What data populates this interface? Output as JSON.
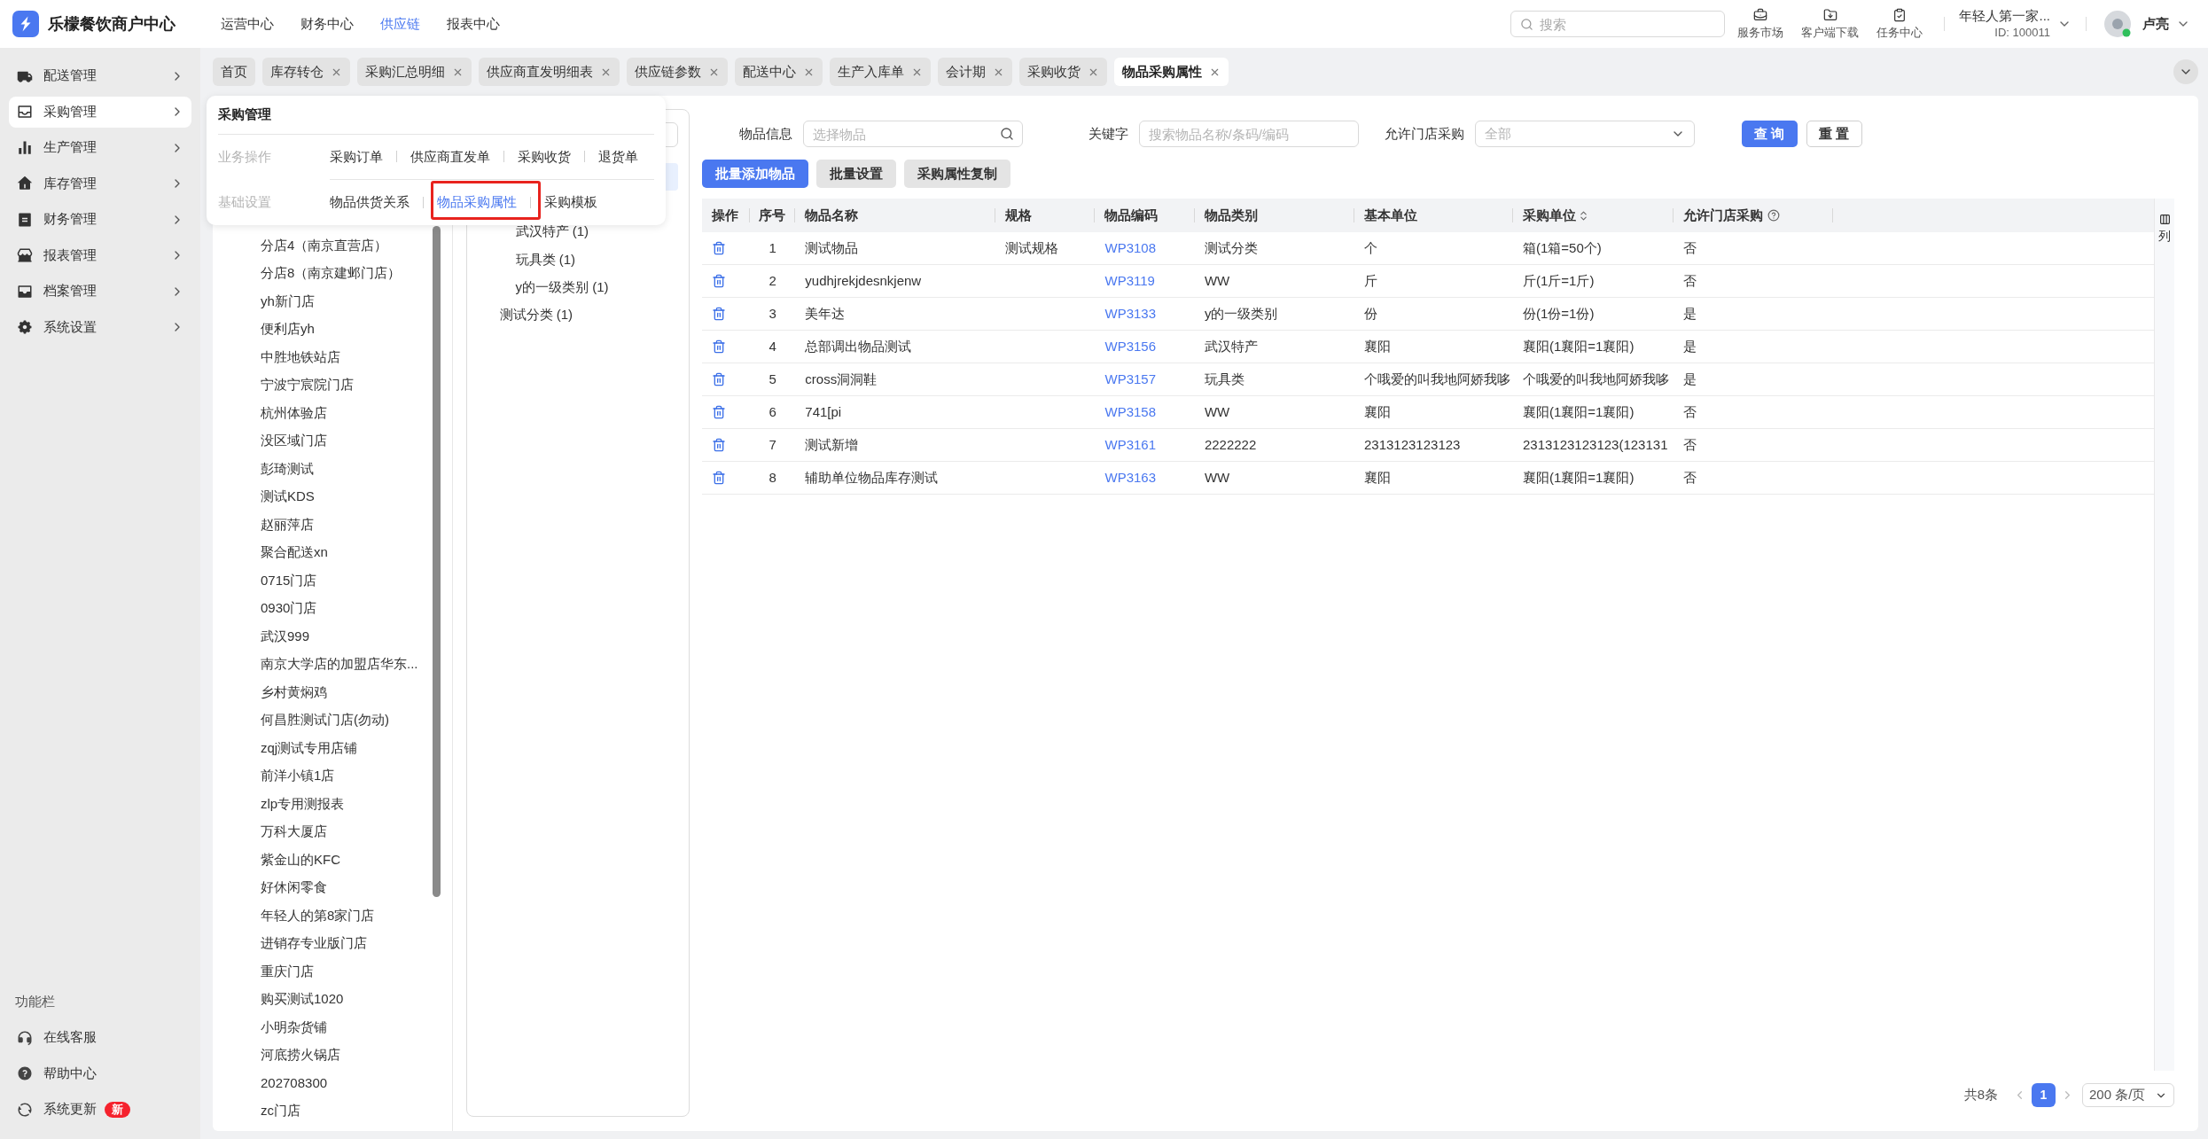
{
  "header": {
    "title": "乐檬餐饮商户中心",
    "nav": [
      {
        "label": "运营中心",
        "selected": false
      },
      {
        "label": "财务中心",
        "selected": false
      },
      {
        "label": "供应链",
        "selected": true
      },
      {
        "label": "报表中心",
        "selected": false
      }
    ],
    "search": {
      "placeholder": "搜索"
    },
    "tools": [
      {
        "label": "服务市场",
        "kind": "market"
      },
      {
        "label": "客户端下载",
        "kind": "download"
      },
      {
        "label": "任务中心",
        "kind": "tasks"
      }
    ],
    "account": {
      "name": "年轻人第一家...",
      "id": "ID: 100011"
    },
    "user": {
      "name": "卢亮"
    }
  },
  "sidebar": {
    "items": [
      {
        "label": "配送管理",
        "kind": "truck",
        "selected": false
      },
      {
        "label": "采购管理",
        "kind": "tray",
        "selected": true
      },
      {
        "label": "生产管理",
        "kind": "chart",
        "selected": false
      },
      {
        "label": "库存管理",
        "kind": "house",
        "selected": false
      },
      {
        "label": "财务管理",
        "kind": "bill",
        "selected": false
      },
      {
        "label": "报表管理",
        "kind": "store",
        "selected": false
      },
      {
        "label": "档案管理",
        "kind": "archive",
        "selected": false
      },
      {
        "label": "系统设置",
        "kind": "gear",
        "selected": false
      }
    ],
    "footer": {
      "title": "功能栏",
      "items": [
        {
          "label": "在线客服",
          "kind": "service"
        },
        {
          "label": "帮助中心",
          "kind": "help"
        },
        {
          "label": "系统更新",
          "kind": "update",
          "badge": "新"
        }
      ]
    }
  },
  "tabs": [
    {
      "label": "首页",
      "closable": false,
      "selected": false
    },
    {
      "label": "库存转仓",
      "closable": true,
      "selected": false
    },
    {
      "label": "采购汇总明细",
      "closable": true,
      "selected": false
    },
    {
      "label": "供应商直发明细表",
      "closable": true,
      "selected": false
    },
    {
      "label": "供应链参数",
      "closable": true,
      "selected": false
    },
    {
      "label": "配送中心",
      "closable": true,
      "selected": false
    },
    {
      "label": "生产入库单",
      "closable": true,
      "selected": false
    },
    {
      "label": "会计期",
      "closable": true,
      "selected": false
    },
    {
      "label": "采购收货",
      "closable": true,
      "selected": false
    },
    {
      "label": "物品采购属性",
      "closable": true,
      "selected": true
    }
  ],
  "menu": {
    "title": "采购管理",
    "groups": [
      {
        "label": "业务操作",
        "links": [
          {
            "label": "采购订单",
            "selected": false,
            "outlined": false
          },
          {
            "label": "供应商直发单",
            "selected": false,
            "outlined": false
          },
          {
            "label": "采购收货",
            "selected": false,
            "outlined": false
          },
          {
            "label": "退货单",
            "selected": false,
            "outlined": false
          }
        ]
      },
      {
        "label": "基础设置",
        "links": [
          {
            "label": "物品供货关系",
            "selected": false,
            "outlined": false
          },
          {
            "label": "物品采购属性",
            "selected": true,
            "outlined": true
          },
          {
            "label": "采购模板",
            "selected": false,
            "outlined": false
          }
        ]
      }
    ]
  },
  "stores": [
    "分店4（南京直营店）",
    "分店8（南京建邺门店）",
    "yh新门店",
    "便利店yh",
    "中胜地铁站店",
    "宁波宁宸院门店",
    "杭州体验店",
    "没区域门店",
    "彭琦测试",
    "测试KDS",
    "赵丽萍店",
    "聚合配送xn",
    "0715门店",
    "0930门店",
    "武汉999",
    "南京大学店的加盟店华东...",
    "乡村黄焖鸡",
    "何昌胜测试门店(勿动)",
    "zqj测试专用店铺",
    "前洋小镇1店",
    "zlp专用测报表",
    "万科大厦店",
    "紫金山的KFC",
    "好休闲零食",
    "年轻人的第8家门店",
    "进销存专业版门店",
    "重庆门店",
    "购买测试1020",
    "小明杂货铺",
    "河底捞火锅店",
    "202708300",
    "zc门店"
  ],
  "category_tree": {
    "items": [
      {
        "selected": true,
        "children": [
          {
            "selected": false,
            "children": [
              {
                "label": "武汉特产 (1)",
                "selected": false
              },
              {
                "label": "玩具类 (1)",
                "selected": false
              },
              {
                "label": "y的一级类别 (1)",
                "selected": false
              }
            ]
          },
          {
            "label": "测试分类 (1)",
            "selected": false
          }
        ]
      }
    ]
  },
  "filters": [
    {
      "label": "物品信息",
      "placeholder": "选择物品",
      "kind": "search"
    },
    {
      "label": "关键字",
      "placeholder": "搜索物品名称/条码/编码",
      "kind": "text"
    },
    {
      "label": "允许门店采购",
      "placeholder": "全部",
      "kind": "select"
    }
  ],
  "filter_buttons": [
    {
      "label": "查 询",
      "kind": "primary"
    },
    {
      "label": "重 置",
      "kind": "default"
    }
  ],
  "actions": [
    {
      "label": "批量添加物品",
      "kind": "primary"
    },
    {
      "label": "批量设置",
      "kind": "secondary"
    },
    {
      "label": "采购属性复制",
      "kind": "secondary"
    }
  ],
  "table": {
    "columns": [
      {
        "label": "操作",
        "kind": "action",
        "sortable": false,
        "help": false
      },
      {
        "label": "序号",
        "kind": "no",
        "sortable": false,
        "help": false
      },
      {
        "label": "物品名称",
        "kind": "name",
        "sortable": false,
        "help": false
      },
      {
        "label": "规格",
        "kind": "spec",
        "sortable": false,
        "help": false
      },
      {
        "label": "物品编码",
        "kind": "code",
        "sortable": false,
        "help": false
      },
      {
        "label": "物品类别",
        "kind": "category",
        "sortable": false,
        "help": false
      },
      {
        "label": "基本单位",
        "kind": "base_unit",
        "sortable": false,
        "help": false
      },
      {
        "label": "采购单位",
        "kind": "purchase_unit",
        "sortable": true,
        "help": false
      },
      {
        "label": "允许门店采购",
        "kind": "store_purchase",
        "sortable": false,
        "help": true
      }
    ],
    "rows": [
      {
        "no": "1",
        "name": "测试物品",
        "spec": "测试规格",
        "code": "WP3108",
        "category": "测试分类",
        "base_unit": "个",
        "purchase_unit": "箱(1箱=50个)",
        "store_purchase": "否"
      },
      {
        "no": "2",
        "name": "yudhjrekjdesnkjenw",
        "code": "WP3119",
        "category": "WW",
        "base_unit": "斤",
        "purchase_unit": "斤(1斤=1斤)",
        "store_purchase": "否"
      },
      {
        "no": "3",
        "name": "美年达",
        "code": "WP3133",
        "category": "y的一级类别",
        "base_unit": "份",
        "purchase_unit": "份(1份=1份)",
        "store_purchase": "是"
      },
      {
        "no": "4",
        "name": "总部调出物品测试",
        "code": "WP3156",
        "category": "武汉特产",
        "base_unit": "襄阳",
        "purchase_unit": "襄阳(1襄阳=1襄阳)",
        "store_purchase": "是"
      },
      {
        "no": "5",
        "name": "cross洞洞鞋",
        "code": "WP3157",
        "category": "玩具类",
        "base_unit": "个哦爱的叫我地阿娇我哆",
        "purchase_unit": "个哦爱的叫我地阿娇我哆",
        "store_purchase": "是"
      },
      {
        "no": "6",
        "name": "741[pi",
        "code": "WP3158",
        "category": "WW",
        "base_unit": "襄阳",
        "purchase_unit": "襄阳(1襄阳=1襄阳)",
        "store_purchase": "否"
      },
      {
        "no": "7",
        "name": "测试新增",
        "code": "WP3161",
        "category": "2222222",
        "base_unit": "2313123123123",
        "purchase_unit": "2313123123123(123131",
        "store_purchase": "否"
      },
      {
        "no": "8",
        "name": "辅助单位物品库存测试",
        "code": "WP3163",
        "category": "WW",
        "base_unit": "襄阳",
        "purchase_unit": "襄阳(1襄阳=1襄阳)",
        "store_purchase": "否"
      }
    ],
    "column_settings": "列"
  },
  "pagination": {
    "total": "共8条",
    "pages": [
      {
        "label": "1",
        "selected": true
      }
    ],
    "page_size": "200 条/页"
  }
}
